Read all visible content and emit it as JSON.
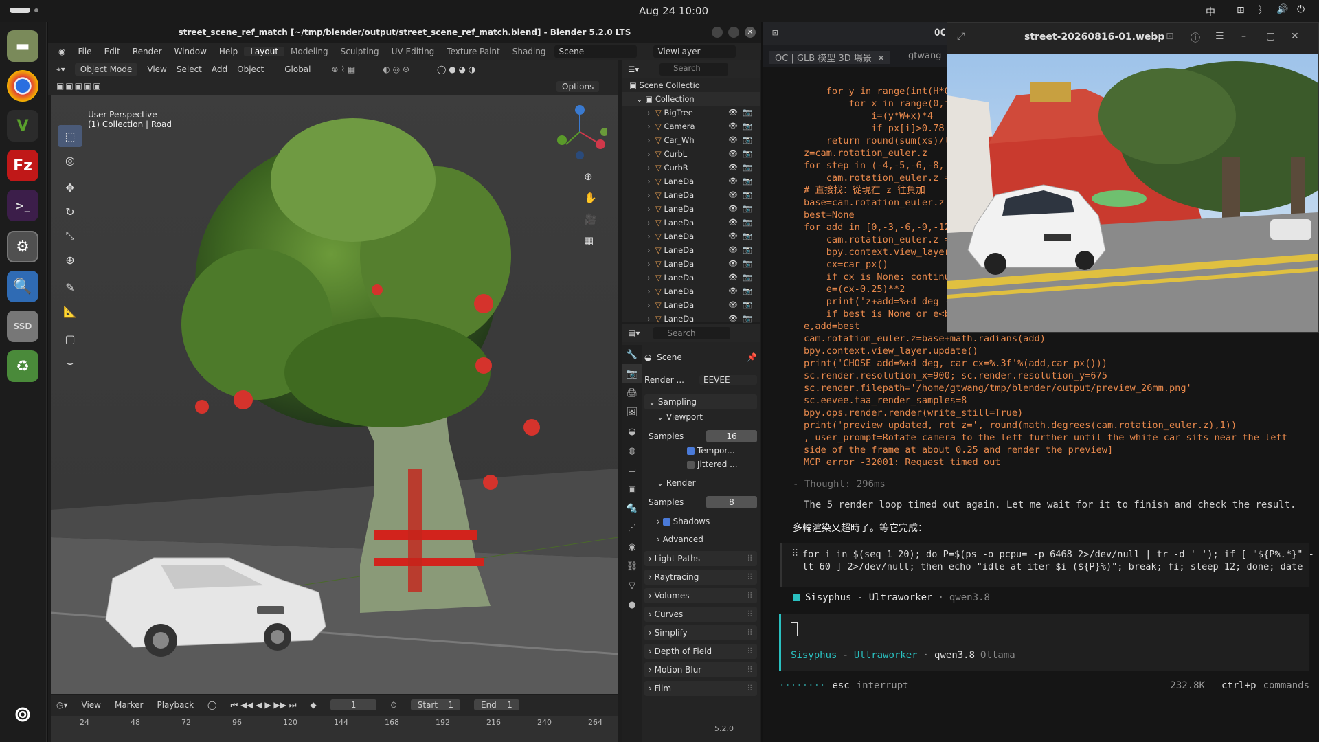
{
  "system": {
    "date": "Aug 24 10:00",
    "input_method": "中"
  },
  "blender": {
    "title": "street_scene_ref_match [~/tmp/blender/output/street_scene_ref_match.blend] - Blender 5.2.0 LTS",
    "menu": [
      "File",
      "Edit",
      "Render",
      "Window",
      "Help"
    ],
    "workspaces": [
      "Layout",
      "Modeling",
      "Sculpting",
      "UV Editing",
      "Texture Paint",
      "Shading"
    ],
    "scene": "Scene",
    "view_layer": "ViewLayer",
    "viewport": {
      "mode": "Object Mode",
      "menu": [
        "View",
        "Select",
        "Add",
        "Object"
      ],
      "orientation": "Global",
      "options": "Options",
      "overlay_line1": "User Perspective",
      "overlay_line2": "(1) Collection | Road"
    },
    "timeline": {
      "menu": [
        "View",
        "Marker",
        "Playback"
      ],
      "frame": "1",
      "start_label": "Start",
      "start": "1",
      "end_label": "End",
      "end": "1",
      "ticks": [
        "24",
        "48",
        "72",
        "96",
        "120",
        "144",
        "168",
        "192",
        "216",
        "240",
        "264"
      ]
    },
    "outliner": {
      "search_placeholder": "Search",
      "root": "Scene Collectio",
      "collection": "Collection",
      "items": [
        "BigTree",
        "Camera",
        "Car_Wh",
        "CurbL",
        "CurbR",
        "LaneDa",
        "LaneDa",
        "LaneDa",
        "LaneDa",
        "LaneDa",
        "LaneDa",
        "LaneDa",
        "LaneDa",
        "LaneDa",
        "LaneDa",
        "LaneDa"
      ]
    },
    "properties": {
      "search_placeholder": "Search",
      "scene": "Scene",
      "render_label": "Render ...",
      "engine": "EEVEE",
      "sampling": "Sampling",
      "viewport": "Viewport",
      "samples_label": "Samples",
      "viewport_samples": "16",
      "temporal": "Tempor...",
      "jittered": "Jittered ...",
      "render": "Render",
      "render_samples": "8",
      "shadows": "Shadows",
      "advanced": "Advanced",
      "panels": [
        "Light Paths",
        "Raytracing",
        "Volumes",
        "Curves",
        "Simplify",
        "Depth of Field",
        "Motion Blur",
        "Film"
      ]
    },
    "status_version": "5.2.0"
  },
  "terminal": {
    "window_title": "OC",
    "tab1": "OC | GLB 模型 3D 場景",
    "tab2": "gtwang",
    "code": "    for y in range(int(H*0\n        for x in range(0,i\n            i=(y*W+x)*4\n            if px[i]>0.78\n    return round(sum(xs)/l\nz=cam.rotation_euler.z\nfor step in (-4,-5,-6,-8,\n    cam.rotation_euler.z =\n# 直接找：從現在 z 往負加\nbase=cam.rotation_euler.z\nbest=None\nfor add in [0,-3,-6,-9,-12\n    cam.rotation_euler.z =\n    bpy.context.view_layer\n    cx=car_px()\n    if cx is None: continu\n    e=(cx-0.25)**2\n    print('z+add=%+d deg -\n    if best is None or e<b\ne,add=best\ncam.rotation_euler.z=base+math.radians(add)\nbpy.context.view_layer.update()\nprint('CHOSE add=%+d deg, car cx=%.3f'%(add,car_px()))\nsc.render.resolution_x=900; sc.render.resolution_y=675\nsc.render.filepath='/home/gtwang/tmp/blender/output/preview_26mm.png'\nsc.eevee.taa_render_samples=8\nbpy.ops.render.render(write_still=True)\nprint('preview updated, rot z=', round(math.degrees(cam.rotation_euler.z),1))\n, user_prompt=Rotate camera to the left further until the white car sits near the left\nside of the frame at about 0.25 and render the preview]\nMCP error -32001: Request timed out",
    "thought": "- Thought: 296ms",
    "message_en": "The 5 render loop timed out again. Let me wait for it to finish and check the result.",
    "message_zh": "多輪渲染又超時了。等它完成：",
    "command": "for i in $(seq 1 20); do P=$(ps -o pcpu= -p 6468 2>/dev/null | tr -d ' '); if [ \"${P%.*}\" -\nlt 60 ] 2>/dev/null; then echo \"idle at iter $i (${P}%)\"; break; fi; sleep 12; done; date",
    "agent1": "Sisyphus - Ultraworker",
    "model1": "qwen3.8",
    "agent_name": "Sisyphus",
    "agent_role": "Ultraworker",
    "model2": "qwen3.8",
    "provider": "Ollama",
    "esc": "esc",
    "interrupt": "interrupt",
    "tokens": "232.8K",
    "cmd_key": "ctrl+p",
    "cmd_label": "commands"
  },
  "image_viewer": {
    "title": "street-20260816-01.webp"
  }
}
